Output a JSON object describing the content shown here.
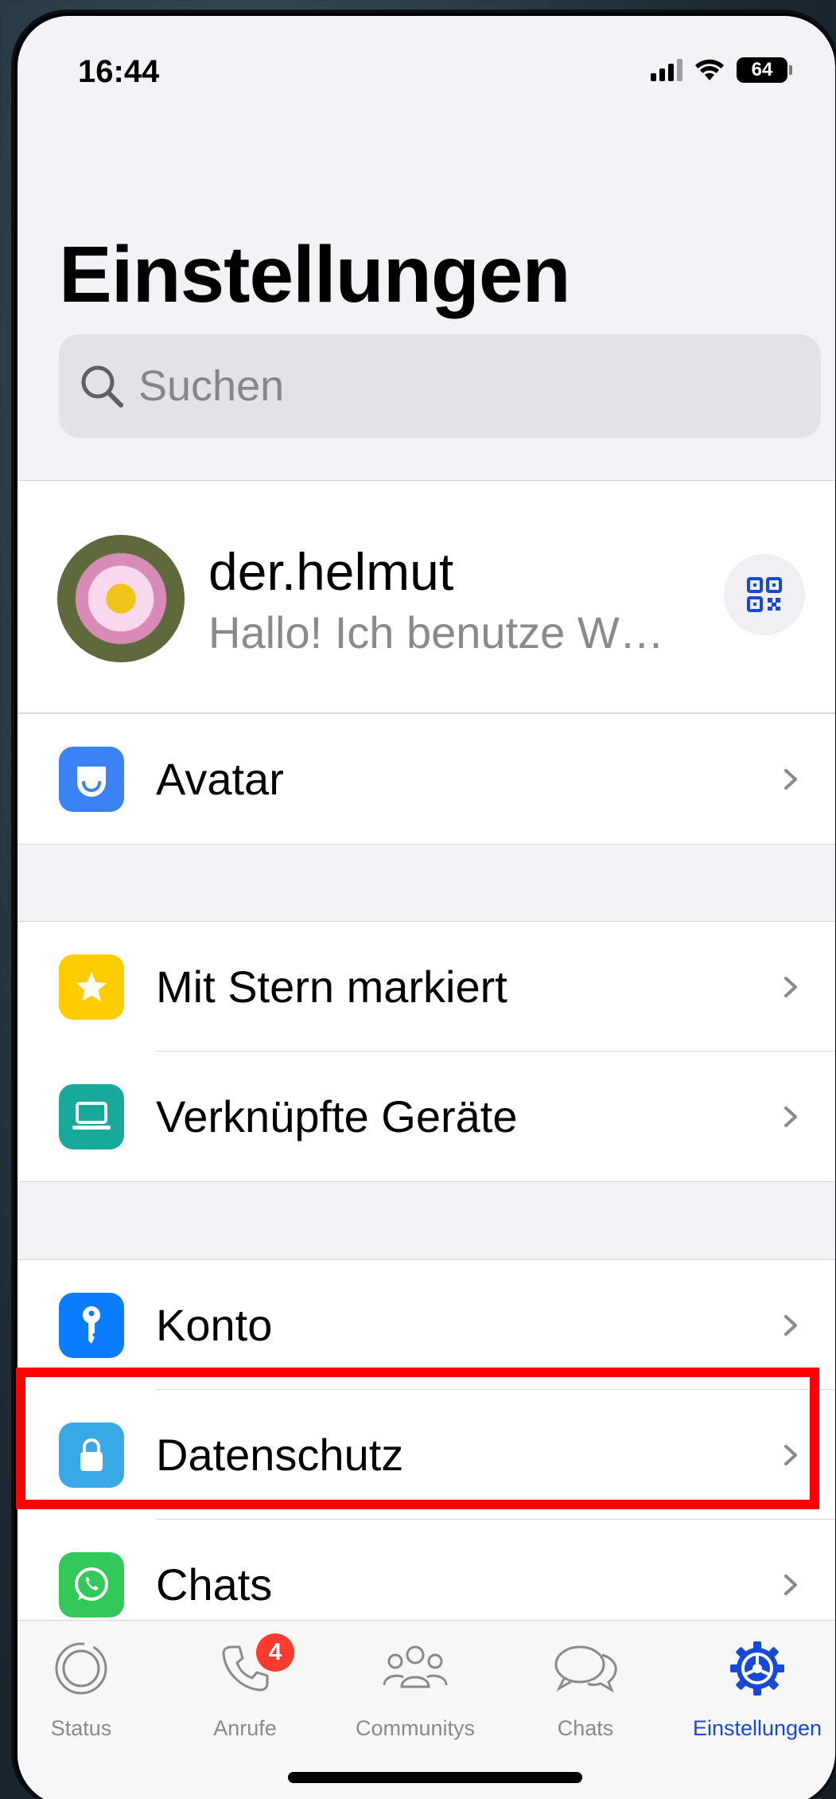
{
  "status_bar": {
    "time": "16:44",
    "battery": "64"
  },
  "page_title": "Einstellungen",
  "search": {
    "placeholder": "Suchen"
  },
  "profile": {
    "name": "der.helmut",
    "status": "Hallo! Ich benutze W…"
  },
  "rows": {
    "avatar": "Avatar",
    "starred": "Mit Stern markiert",
    "linked_devices": "Verknüpfte Geräte",
    "account": "Konto",
    "privacy": "Datenschutz",
    "chats": "Chats"
  },
  "tabs": {
    "status": "Status",
    "calls": "Anrufe",
    "calls_badge": "4",
    "communities": "Communitys",
    "chats": "Chats",
    "settings": "Einstellungen"
  },
  "colors": {
    "accent": "#1748d6",
    "highlight": "#ff0000",
    "avatar_icon": "#3b82f6",
    "star_icon": "#ffcc00",
    "devices_icon": "#18a99a",
    "account_icon": "#0a7cff",
    "privacy_icon": "#38a8e6",
    "chats_icon": "#33c95a"
  }
}
